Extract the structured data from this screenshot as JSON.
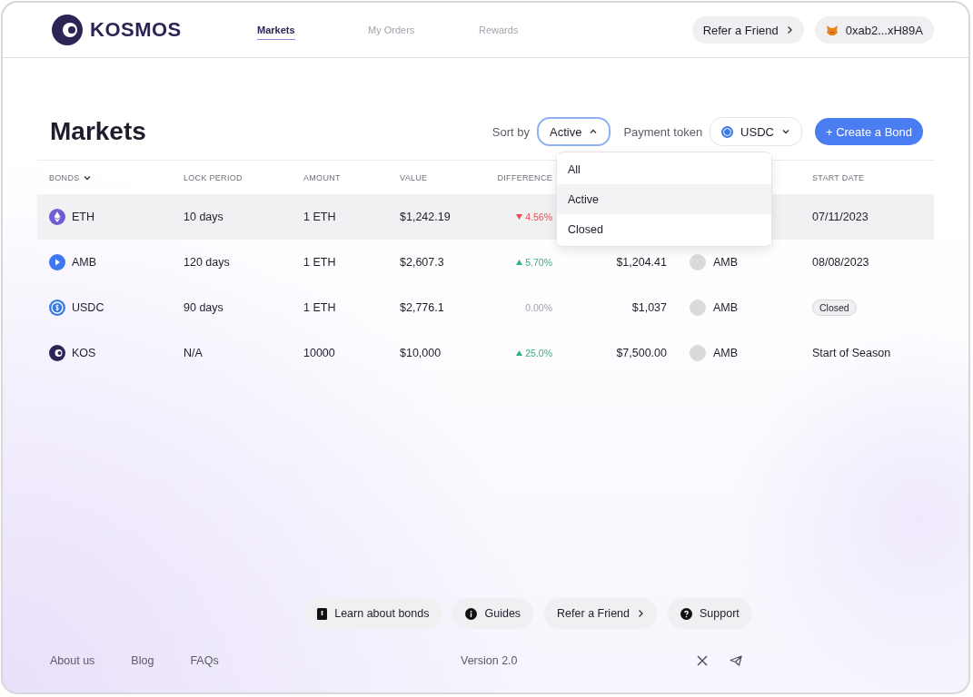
{
  "header": {
    "logo": "KOSMOS",
    "nav": [
      {
        "label": "Markets",
        "selected": true
      },
      {
        "label": "My Orders",
        "selected": false
      },
      {
        "label": "Rewards",
        "selected": false
      }
    ],
    "refer": "Refer a Friend",
    "wallet": "0xab2...xH89A"
  },
  "page": {
    "title": "Markets",
    "sort_label": "Sort by",
    "sort": {
      "value": "Active",
      "expanded": true,
      "options": [
        {
          "label": "All",
          "selected": false
        },
        {
          "label": "Active",
          "selected": true
        },
        {
          "label": "Closed",
          "selected": false
        }
      ]
    },
    "payment_label": "Payment token",
    "payment_token": "USDC",
    "create": "+ Create a Bond"
  },
  "table": {
    "columns": [
      {
        "label": "BONDS",
        "sortable": true
      },
      {
        "label": "LOCK PERIOD",
        "sortable": false
      },
      {
        "label": "AMOUNT",
        "sortable": false
      },
      {
        "label": "VALUE",
        "sortable": false
      },
      {
        "label": "DIFFERENCE",
        "sortable": false
      },
      {
        "label": "START DATE",
        "sortable": false
      }
    ],
    "rows": [
      {
        "kind": "eth",
        "bond": "ETH",
        "lock": "10 days",
        "amount": "1 ETH",
        "value": "$1,242.19",
        "difference": {
          "text": "4.56%",
          "kind": "down"
        },
        "start": {
          "text": "07/11/2023",
          "kind": "text"
        },
        "highlighted": true
      },
      {
        "kind": "amb",
        "bond": "AMB",
        "lock": "120 days",
        "amount": "1 ETH",
        "value": "$2,607.3",
        "difference": {
          "text": "5.70%",
          "kind": "up"
        },
        "column_6": "$1,204.41",
        "column_7": "AMB",
        "start": {
          "text": "08/08/2023",
          "kind": "text"
        },
        "highlighted": false
      },
      {
        "kind": "usdc",
        "bond": "USDC",
        "lock": "90 days",
        "amount": "1 ETH",
        "value": "$2,776.1",
        "difference": {
          "text": "0.00%",
          "kind": "flat"
        },
        "column_6": "$1,037",
        "column_7": "AMB",
        "start": {
          "text": "Closed",
          "kind": "badge"
        },
        "highlighted": false
      },
      {
        "kind": "kos",
        "bond": "KOS",
        "lock": "N/A",
        "amount": "10000",
        "value": "$10,000",
        "difference": {
          "text": "25.0%",
          "kind": "up"
        },
        "column_6": "$7,500.00",
        "column_7": "AMB",
        "start": {
          "text": "Start of Season",
          "kind": "text"
        },
        "highlighted": false
      }
    ]
  },
  "footer": {
    "buttons": [
      {
        "kind": "book",
        "label": "Learn about bonds"
      },
      {
        "kind": "info",
        "label": "Guides"
      },
      {
        "kind": "chevron",
        "label": "Refer a Friend"
      },
      {
        "kind": "help",
        "label": "Support"
      }
    ],
    "links": [
      "About us",
      "Blog",
      "FAQs"
    ],
    "version": "Version 2.0"
  }
}
